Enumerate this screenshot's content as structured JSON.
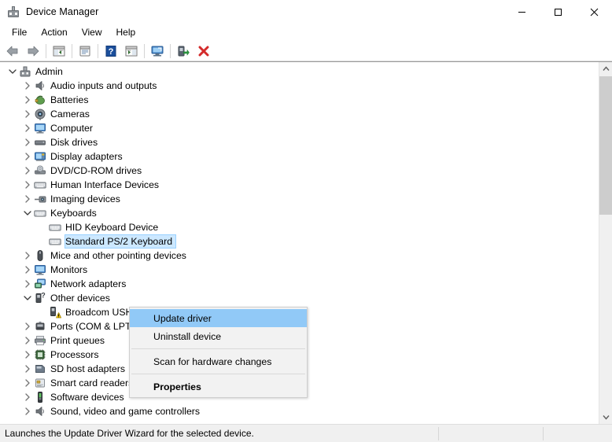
{
  "window": {
    "title": "Device Manager",
    "title_icon": "device-manager-icon",
    "controls": [
      {
        "name": "minimize",
        "glyph": "minimize-icon"
      },
      {
        "name": "maximize",
        "glyph": "maximize-icon"
      },
      {
        "name": "close",
        "glyph": "close-icon"
      }
    ]
  },
  "menubar": {
    "items": [
      {
        "label": "File"
      },
      {
        "label": "Action"
      },
      {
        "label": "View"
      },
      {
        "label": "Help"
      }
    ]
  },
  "toolbar": {
    "buttons": [
      {
        "name": "back-button",
        "icon": "back-arrow-icon"
      },
      {
        "name": "forward-button",
        "icon": "forward-arrow-icon"
      },
      {
        "name": "separator-1",
        "icon": "separator"
      },
      {
        "name": "show-hide-console-tree-button",
        "icon": "console-tree-icon"
      },
      {
        "name": "separator-2",
        "icon": "separator"
      },
      {
        "name": "properties-button",
        "icon": "properties-icon"
      },
      {
        "name": "separator-3",
        "icon": "separator"
      },
      {
        "name": "help-button",
        "icon": "help-question-icon"
      },
      {
        "name": "show-hide-action-pane-button",
        "icon": "action-pane-icon"
      },
      {
        "name": "separator-4",
        "icon": "separator"
      },
      {
        "name": "update-driver-button",
        "icon": "monitor-scan-icon"
      },
      {
        "name": "separator-5",
        "icon": "separator"
      },
      {
        "name": "scan-for-hardware-changes-button",
        "icon": "scan-hardware-icon"
      },
      {
        "name": "uninstall-device-button",
        "icon": "red-x-icon"
      }
    ]
  },
  "tree": {
    "nodes": [
      {
        "label": "Admin",
        "depth": 0,
        "state": "expanded",
        "icon": "computer-root-icon",
        "selected": false
      },
      {
        "label": "Audio inputs and outputs",
        "depth": 1,
        "state": "collapsed",
        "icon": "speaker-icon",
        "selected": false
      },
      {
        "label": "Batteries",
        "depth": 1,
        "state": "collapsed",
        "icon": "battery-icon",
        "selected": false
      },
      {
        "label": "Cameras",
        "depth": 1,
        "state": "collapsed",
        "icon": "camera-icon",
        "selected": false
      },
      {
        "label": "Computer",
        "depth": 1,
        "state": "collapsed",
        "icon": "monitor-icon",
        "selected": false
      },
      {
        "label": "Disk drives",
        "depth": 1,
        "state": "collapsed",
        "icon": "disk-drive-icon",
        "selected": false
      },
      {
        "label": "Display adapters",
        "depth": 1,
        "state": "collapsed",
        "icon": "display-adapter-icon",
        "selected": false
      },
      {
        "label": "DVD/CD-ROM drives",
        "depth": 1,
        "state": "collapsed",
        "icon": "optical-drive-icon",
        "selected": false
      },
      {
        "label": "Human Interface Devices",
        "depth": 1,
        "state": "collapsed",
        "icon": "hid-icon",
        "selected": false
      },
      {
        "label": "Imaging devices",
        "depth": 1,
        "state": "collapsed",
        "icon": "imaging-device-icon",
        "selected": false
      },
      {
        "label": "Keyboards",
        "depth": 1,
        "state": "expanded",
        "icon": "keyboard-icon",
        "selected": false
      },
      {
        "label": "HID Keyboard Device",
        "depth": 2,
        "state": "leaf",
        "icon": "keyboard-icon",
        "selected": false
      },
      {
        "label": "Standard PS/2 Keyboard",
        "depth": 2,
        "state": "leaf",
        "icon": "keyboard-icon",
        "selected": true
      },
      {
        "label": "Mice and other pointing devices",
        "depth": 1,
        "state": "collapsed",
        "icon": "mouse-icon",
        "selected": false
      },
      {
        "label": "Monitors",
        "depth": 1,
        "state": "collapsed",
        "icon": "monitor-icon",
        "selected": false
      },
      {
        "label": "Network adapters",
        "depth": 1,
        "state": "collapsed",
        "icon": "network-adapter-icon",
        "selected": false
      },
      {
        "label": "Other devices",
        "depth": 1,
        "state": "expanded",
        "icon": "unknown-device-icon",
        "selected": false
      },
      {
        "label": "Broadcom USH",
        "depth": 2,
        "state": "leaf",
        "icon": "unknown-device-warning-icon",
        "selected": false
      },
      {
        "label": "Ports (COM & LPT)",
        "depth": 1,
        "state": "collapsed",
        "icon": "port-icon",
        "selected": false
      },
      {
        "label": "Print queues",
        "depth": 1,
        "state": "collapsed",
        "icon": "printer-icon",
        "selected": false
      },
      {
        "label": "Processors",
        "depth": 1,
        "state": "collapsed",
        "icon": "processor-icon",
        "selected": false
      },
      {
        "label": "SD host adapters",
        "depth": 1,
        "state": "collapsed",
        "icon": "sd-host-icon",
        "selected": false
      },
      {
        "label": "Smart card readers",
        "depth": 1,
        "state": "collapsed",
        "icon": "smart-card-icon",
        "selected": false
      },
      {
        "label": "Software devices",
        "depth": 1,
        "state": "collapsed",
        "icon": "software-device-icon",
        "selected": false
      },
      {
        "label": "Sound, video and game controllers",
        "depth": 1,
        "state": "collapsed",
        "icon": "speaker-icon",
        "selected": false
      }
    ]
  },
  "context_menu": {
    "items": [
      {
        "label": "Update driver",
        "type": "item",
        "highlighted": true,
        "bold": false
      },
      {
        "label": "Uninstall device",
        "type": "item",
        "highlighted": false,
        "bold": false
      },
      {
        "type": "separator"
      },
      {
        "label": "Scan for hardware changes",
        "type": "item",
        "highlighted": false,
        "bold": false
      },
      {
        "type": "separator"
      },
      {
        "label": "Properties",
        "type": "item",
        "highlighted": false,
        "bold": true
      }
    ]
  },
  "statusbar": {
    "message": "Launches the Update Driver Wizard for the selected device."
  },
  "colors": {
    "selection_blue": "#cce8ff",
    "menu_highlight_blue": "#91c9f7",
    "window_bg": "#ffffff",
    "statusbar_bg": "#f0f0f0",
    "warning_yellow": "#ffd200",
    "close_red": "#e81123"
  }
}
